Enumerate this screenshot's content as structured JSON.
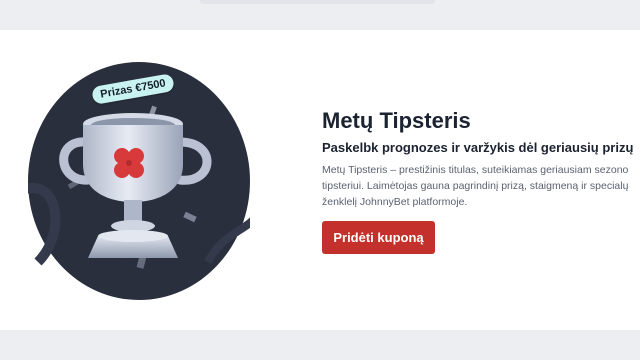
{
  "promo": {
    "prize_badge": "Prizas €7500",
    "title": "Metų Tipsteris",
    "subtitle": "Paskelbk prognozes ir varžykis dėl geriausių prizų",
    "description": "Metų Tipsteris – prestižinis titulas, suteikiamas geriausiam sezono tipsteriui. Laimėtojas gauna pagrindinį prizą, staigmeną ir specialų ženklelį JohnnyBet platformoje.",
    "cta_label": "Pridėti kuponą"
  },
  "colors": {
    "page_background": "#eceef2",
    "card_background": "#ffffff",
    "hero_background": "#2a2f3e",
    "badge_background": "#c8f3f0",
    "accent_red": "#c4302b",
    "heading_text": "#1b2230",
    "body_text": "#5b6270"
  },
  "icons": {
    "trophy": "trophy-icon",
    "clover": "clover-icon"
  }
}
